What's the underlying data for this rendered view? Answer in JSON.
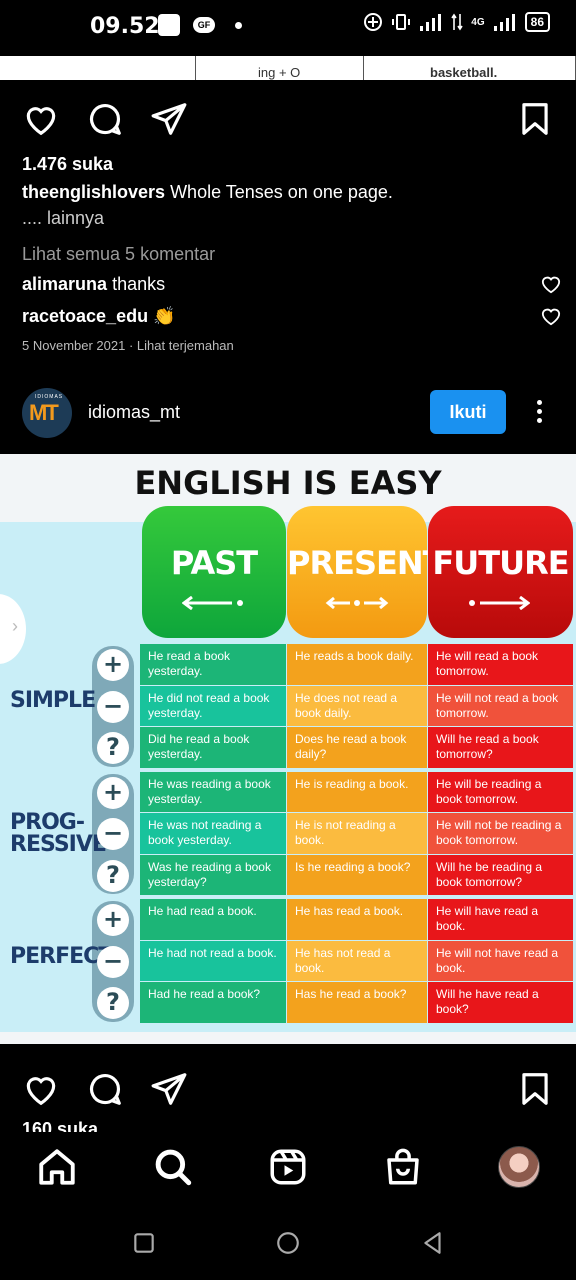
{
  "status_bar": {
    "time": "09.52",
    "notif_badge": "GF",
    "network": "4G",
    "battery": "86"
  },
  "previous_post_strip": {
    "cell_1": "ing + O",
    "cell_2": "basketball."
  },
  "post1": {
    "likes": "1.476 suka",
    "username": "theenglishlovers",
    "caption": "Whole Tenses on one page.",
    "more": ".... lainnya",
    "view_comments": "Lihat semua 5 komentar",
    "comments": [
      {
        "user": "alimaruna",
        "text": "thanks"
      },
      {
        "user": "racetoace_edu",
        "text": "👏"
      }
    ],
    "date": "5 November 2021",
    "translate": "Lihat terjemahan"
  },
  "post2": {
    "username": "idiomas_mt",
    "follow_label": "Ikuti",
    "avatar_text": "MT",
    "avatar_small": "IDIOMAS",
    "likes": "160 suka"
  },
  "infographic": {
    "title": "ENGLISH IS EASY",
    "columns": [
      "PAST",
      "PRESENT",
      "FUTURE"
    ],
    "rows": [
      {
        "label": "SIMPLE",
        "cells": [
          [
            "He read a book yesterday.",
            "He reads a book daily.",
            "He will read a book tomorrow."
          ],
          [
            "He did not read a book yesterday.",
            "He does not read a book daily.",
            "He will not read a book tomorrow."
          ],
          [
            "Did he read a book yesterday.",
            "Does he read a book daily?",
            "Will he read a book tomorrow?"
          ]
        ]
      },
      {
        "label": "PROG-RESSIVE",
        "cells": [
          [
            "He was reading a book yesterday.",
            "He is reading a book.",
            "He will be reading a book tomorrow."
          ],
          [
            "He was not reading a book yesterday.",
            "He is not reading a book.",
            "He will not be reading a book tomorrow."
          ],
          [
            "Was he reading a book yesterday?",
            "Is he reading a book?",
            "Will he be reading a book tomorrow?"
          ]
        ]
      },
      {
        "label": "PERFECT",
        "cells": [
          [
            "He had read a book.",
            "He has read a book.",
            "He will have read a book."
          ],
          [
            "He had not read a book.",
            "He has not read a book.",
            "He will not have read a book."
          ],
          [
            "Had he read a book?",
            "Has he read a book?",
            "Will he have read a book?"
          ]
        ]
      }
    ],
    "signs": [
      "+",
      "−",
      "?"
    ]
  },
  "colors": {
    "background": "#000000",
    "follow_button": "#1a91f0",
    "past": "#1cb577",
    "present": "#f3a21d",
    "future": "#e8161a"
  },
  "icons": {
    "post_actions": [
      "heart-icon",
      "comment-icon",
      "share-icon",
      "bookmark-icon"
    ],
    "bottom_nav": [
      "home-icon",
      "search-icon",
      "reels-icon",
      "shop-icon",
      "profile-avatar"
    ],
    "system_nav": [
      "recents-icon",
      "home-circle-icon",
      "back-icon"
    ]
  }
}
